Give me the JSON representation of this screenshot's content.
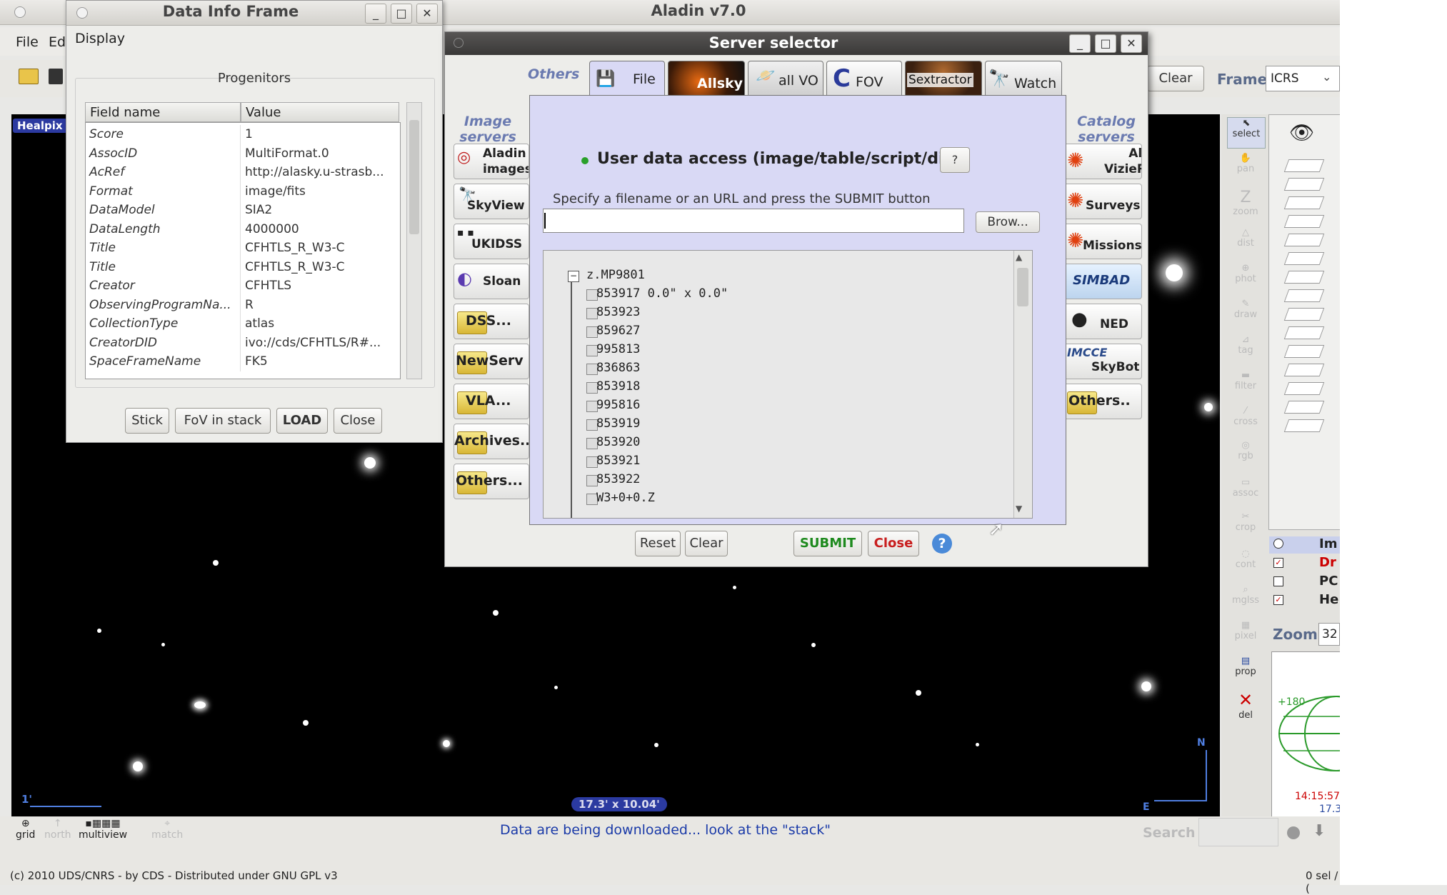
{
  "main_window": {
    "title": "Aladin v7.0",
    "menu": [
      "File",
      "Ed"
    ],
    "clear_label": "Clear",
    "frame_label": "Frame",
    "frame_value": "ICRS",
    "healpix_label": "Healpix",
    "scale_label": "1'",
    "fov_label": "17.3' x 10.04'",
    "compass_n": "N",
    "compass_e": "E",
    "status_message": "Data are being downloaded... look at the \"stack\"",
    "search_label": "Search",
    "copyright": "(c) 2010 UDS/CNRS - by CDS - Distributed under GNU GPL v3",
    "selection_status": "0 sel / (",
    "zoom_label": "Zoom",
    "zoom_value": "32",
    "overview_ra_label": "+180",
    "overview_time": "14:15:57.",
    "overview_dec": "17.3",
    "view_controls": {
      "grid": "grid",
      "north": "north",
      "multiview": "multiview",
      "match": "match"
    },
    "tools": [
      "select",
      "pan",
      "zoom",
      "dist",
      "phot",
      "draw",
      "tag",
      "filter",
      "cross",
      "rgb",
      "assoc",
      "crop",
      "cont",
      "mglss",
      "pixel",
      "prop",
      "del"
    ],
    "stack_layers": [
      {
        "label": "Im",
        "color": "#cc0000",
        "checked": false
      },
      {
        "label": "Dr",
        "color": "#cc0000",
        "checked": true
      },
      {
        "label": "PC",
        "color": "#000000",
        "checked": false
      },
      {
        "label": "He",
        "color": "#000000",
        "checked": true
      }
    ]
  },
  "data_info_frame": {
    "title": "Data Info Frame",
    "menu_display": "Display",
    "section_label": "Progenitors",
    "columns": [
      "Field name",
      "Value"
    ],
    "rows": [
      {
        "field": "Score",
        "value": "1"
      },
      {
        "field": "AssocID",
        "value": "MultiFormat.0"
      },
      {
        "field": "AcRef",
        "value": "http://alasky.u-strasb..."
      },
      {
        "field": "Format",
        "value": "image/fits"
      },
      {
        "field": "DataModel",
        "value": "SIA2"
      },
      {
        "field": "DataLength",
        "value": "4000000"
      },
      {
        "field": "Title",
        "value": "CFHTLS_R_W3-C"
      },
      {
        "field": "Title",
        "value": "CFHTLS_R_W3-C"
      },
      {
        "field": "Creator",
        "value": "CFHTLS"
      },
      {
        "field": "ObservingProgramNa...",
        "value": "R"
      },
      {
        "field": "CollectionType",
        "value": "atlas"
      },
      {
        "field": "CreatorDID",
        "value": "ivo://cds/CFHTLS/R#..."
      },
      {
        "field": "SpaceFrameName",
        "value": "FK5"
      }
    ],
    "buttons": {
      "stick": "Stick",
      "fov": "FoV in stack",
      "load": "LOAD",
      "close": "Close"
    }
  },
  "server_selector": {
    "title": "Server selector",
    "others_label": "Others",
    "tabs": [
      "File",
      "Allsky",
      "all VO",
      "FOV",
      "Sextractor",
      "Watch"
    ],
    "image_servers_label": "Image servers",
    "catalog_servers_label": "Catalog servers",
    "image_servers": [
      "Aladin images",
      "SkyView",
      "UKIDSS",
      "Sloan",
      "DSS...",
      "NewServ",
      "VLA...",
      "Archives...",
      "Others..."
    ],
    "catalog_servers": [
      "All VizieR",
      "Surveys",
      "Missions",
      "SIMBAD",
      "NED",
      "SkyBot",
      "Others.."
    ],
    "heading": "User data access (image/table/script/dir)",
    "help_q": "?",
    "instruction": "Specify a filename or an URL and press the SUBMIT button",
    "url_value": "",
    "browse_label": "Brow...",
    "tree_root": "z.MP9801",
    "tree_items": [
      "853917 0.0\" x 0.0\"",
      "853923",
      "859627",
      "995813",
      "836863",
      "853918",
      "995816",
      "853919",
      "853920",
      "853921",
      "853922",
      "W3+0+0.Z"
    ],
    "buttons": {
      "reset": "Reset",
      "clear": "Clear",
      "submit": "SUBMIT",
      "close": "Close",
      "help": "?"
    }
  }
}
